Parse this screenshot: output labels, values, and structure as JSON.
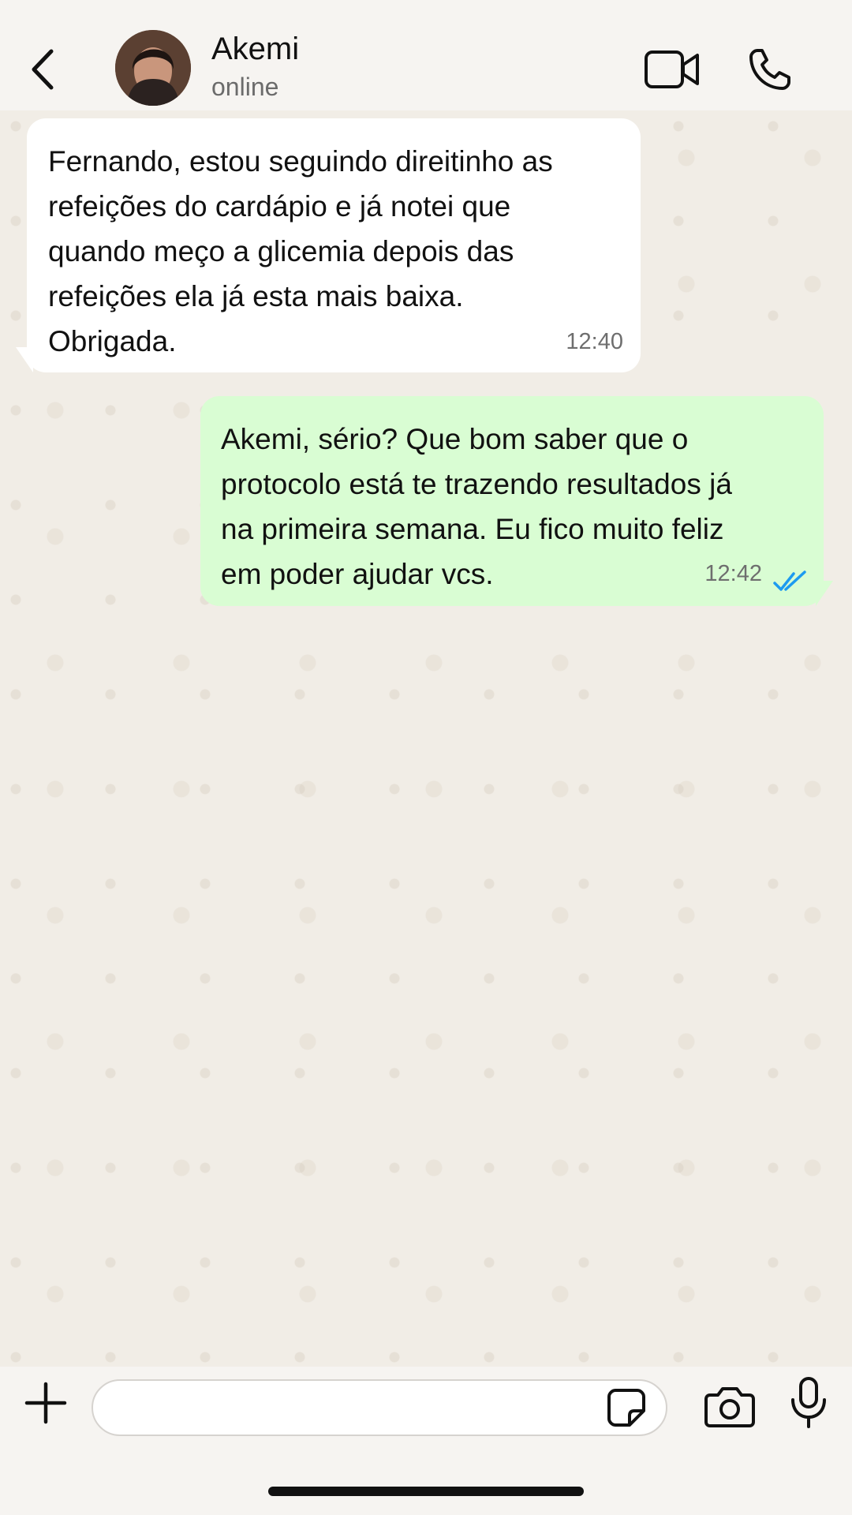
{
  "header": {
    "contact_name": "Akemi",
    "contact_status": "online",
    "icons": {
      "back": "chevron-left-icon",
      "video": "video-camera-icon",
      "call": "phone-icon"
    }
  },
  "messages": [
    {
      "direction": "incoming",
      "text": "Fernando, estou seguindo direitinho as\nrefeições do cardápio e já notei que\nquando meço a glicemia depois das\nrefeições ela já esta mais baixa.\nObrigada.",
      "time": "12:40"
    },
    {
      "direction": "outgoing",
      "text": "Akemi, sério? Que bom saber que o\nprotocolo está te trazendo resultados já\nna primeira semana. Eu fico muito feliz\nem poder ajudar vcs.",
      "time": "12:42",
      "status": "read"
    }
  ],
  "composer": {
    "value": "",
    "icons": {
      "attach": "plus-icon",
      "sticker": "sticker-icon",
      "camera": "camera-icon",
      "mic": "microphone-icon"
    }
  },
  "colors": {
    "incoming_bubble": "#ffffff",
    "outgoing_bubble": "#d9fdd3",
    "read_receipt": "#1d9bf0",
    "wallpaper": "#f1ede6"
  }
}
